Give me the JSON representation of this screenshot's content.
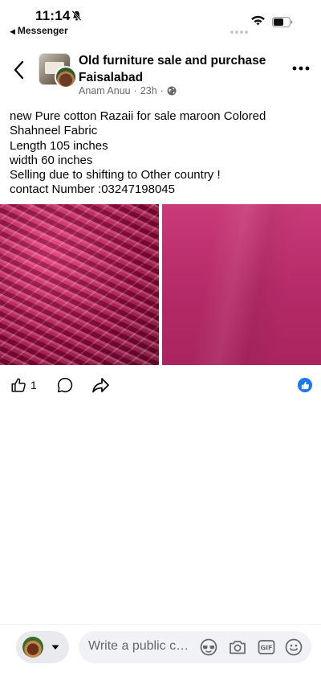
{
  "status_bar": {
    "time": "11:14",
    "back_app": "Messenger"
  },
  "header": {
    "group_name_line1": "Old furniture sale and purchase",
    "group_name_line2": "Faisalabad",
    "author": "Anam Anuu",
    "time_ago": "23h"
  },
  "post": {
    "lines": [
      "new Pure cotton Razaii for sale maroon Colored",
      "Shahneel Fabric",
      "Length 105 inches",
      "width 60 inches",
      "Selling due to shifting to Other country !",
      "contact Number :03247198045"
    ],
    "photo_colors": [
      "#8e0c3b",
      "#b52a68"
    ]
  },
  "actions": {
    "like_count": "1",
    "like_icon": "thumbs-up-icon",
    "comment_icon": "comment-icon",
    "share_icon": "share-icon",
    "reaction_icon": "like-reaction-icon"
  },
  "composer": {
    "placeholder": "Write a public comment…",
    "icons": [
      "sticker-icon",
      "camera-icon",
      "gif-icon",
      "emoji-icon"
    ]
  },
  "colors": {
    "accent": "#1877f2",
    "secondary_text": "#65676b",
    "input_bg": "#f0f2f5"
  }
}
